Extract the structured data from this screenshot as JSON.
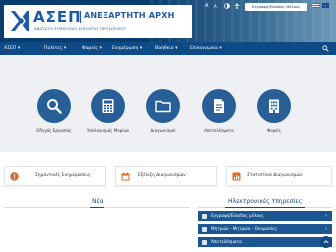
{
  "header": {
    "logo_acronym": "ΑΣΕΠ",
    "logo_name": "ΑΝΕΞΑΡΤΗΤΗ ΑΡΧΗ",
    "logo_subtitle": "ΑΝΩΤΑΤΟ ΣΥΜΒΟΥΛΙΟ ΕΠΙΛΟΓΗΣ ΠΡΟΣΩΠΙΚΟΥ",
    "a11y_text_size": "A",
    "a11y_contrast": "A",
    "login_label": "Εγγραφή/Είσοδος Μέλους",
    "languages": [
      "greek-flag",
      "uk-flag"
    ]
  },
  "nav": {
    "items": [
      {
        "label": "ΑΣΕΠ ▾"
      },
      {
        "label": "Πολίτες ▾"
      },
      {
        "label": "Φορείς ▾"
      },
      {
        "label": "Ενημέρωση ▾"
      },
      {
        "label": "Βοήθεια ▾"
      },
      {
        "label": "Επικοινωνία ▾"
      }
    ],
    "search_icon": "search-icon"
  },
  "quick_links": [
    {
      "label": "Οδηγός Εργασίας",
      "icon": "search-icon"
    },
    {
      "label": "Υπολογισμός Μορίων",
      "icon": "calculator-icon"
    },
    {
      "label": "Διαγωνισμοί",
      "icon": "folder-icon"
    },
    {
      "label": "Αποτελέσματα",
      "icon": "document-icon"
    },
    {
      "label": "Φορείς",
      "icon": "building-icon"
    }
  ],
  "cards": [
    {
      "label": "Σημαντικές Ενημερώσεις",
      "icon": "alert-icon"
    },
    {
      "label": "Εξέλιξη Διαγωνισμών",
      "icon": "calendar-icon"
    },
    {
      "label": "Στατιστικά Διαγωνισμών",
      "icon": "chart-icon"
    }
  ],
  "news": {
    "title": "Νέα"
  },
  "services": {
    "title": "Ηλεκτρονικές Υπηρεσίες",
    "items": [
      {
        "label": "Εγγραφή/Είσοδος μέλους"
      },
      {
        "label": "Μητρώο - Μητρώα - Ονομασίες"
      },
      {
        "label": "Αποτελέσματα"
      }
    ]
  },
  "colors": {
    "primary": "#0d4a86",
    "tile": "#285f96",
    "header_dark": "#0a3d6e",
    "accent_orange": "#e8641b"
  }
}
